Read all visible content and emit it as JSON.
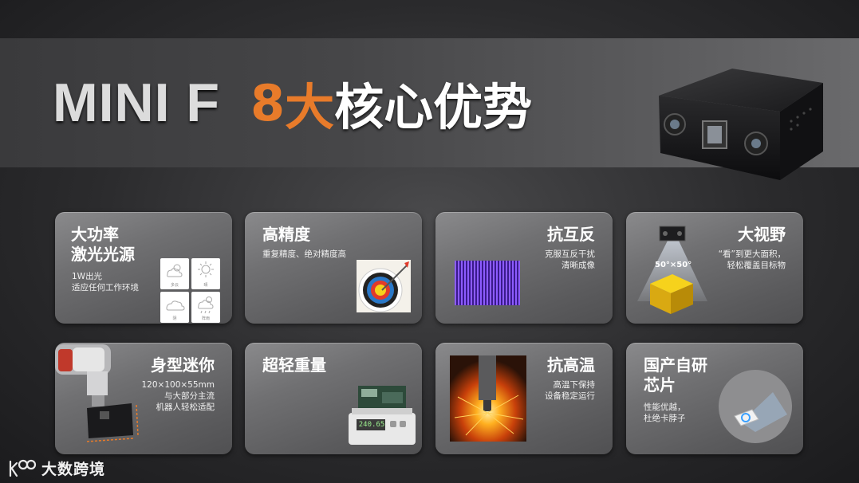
{
  "header": {
    "title_en": "MINI F",
    "title_num": "8",
    "title_emph": "大",
    "title_zh": "核心优势"
  },
  "cards": [
    {
      "title_line1": "大功率",
      "title_line2": "激光光源",
      "desc_line1": "1W出光",
      "desc_line2": "适应任何工作环境",
      "weather_labels": [
        "多云",
        "晴",
        "阴",
        "阵雨"
      ]
    },
    {
      "title": "高精度",
      "desc_line1": "重复精度、绝对精度高"
    },
    {
      "title": "抗互反",
      "desc_line1": "克服互反干扰",
      "desc_line2": "清晰成像"
    },
    {
      "title": "大视野",
      "desc_line1": "“看”到更大面积，",
      "desc_line2": "轻松覆盖目标物",
      "fov_label": "50°×50°"
    },
    {
      "title": "身型迷你",
      "desc_line1": "120×100×55mm",
      "desc_line2": "与大部分主流",
      "desc_line3": "机器人轻松适配"
    },
    {
      "title": "超轻重量",
      "scale_reading": "240.65"
    },
    {
      "title": "抗高温",
      "desc_line1": "高温下保持",
      "desc_line2": "设备稳定运行"
    },
    {
      "title_line1": "国产自研",
      "title_line2": "芯片",
      "desc_line1": "性能优越，",
      "desc_line2": "杜绝卡脖子"
    }
  ],
  "footer": {
    "brand_text": "大数跨境"
  },
  "colors": {
    "accent": "#e87b2a",
    "card_top": "#8a8a8c",
    "card_bottom": "#505052"
  }
}
